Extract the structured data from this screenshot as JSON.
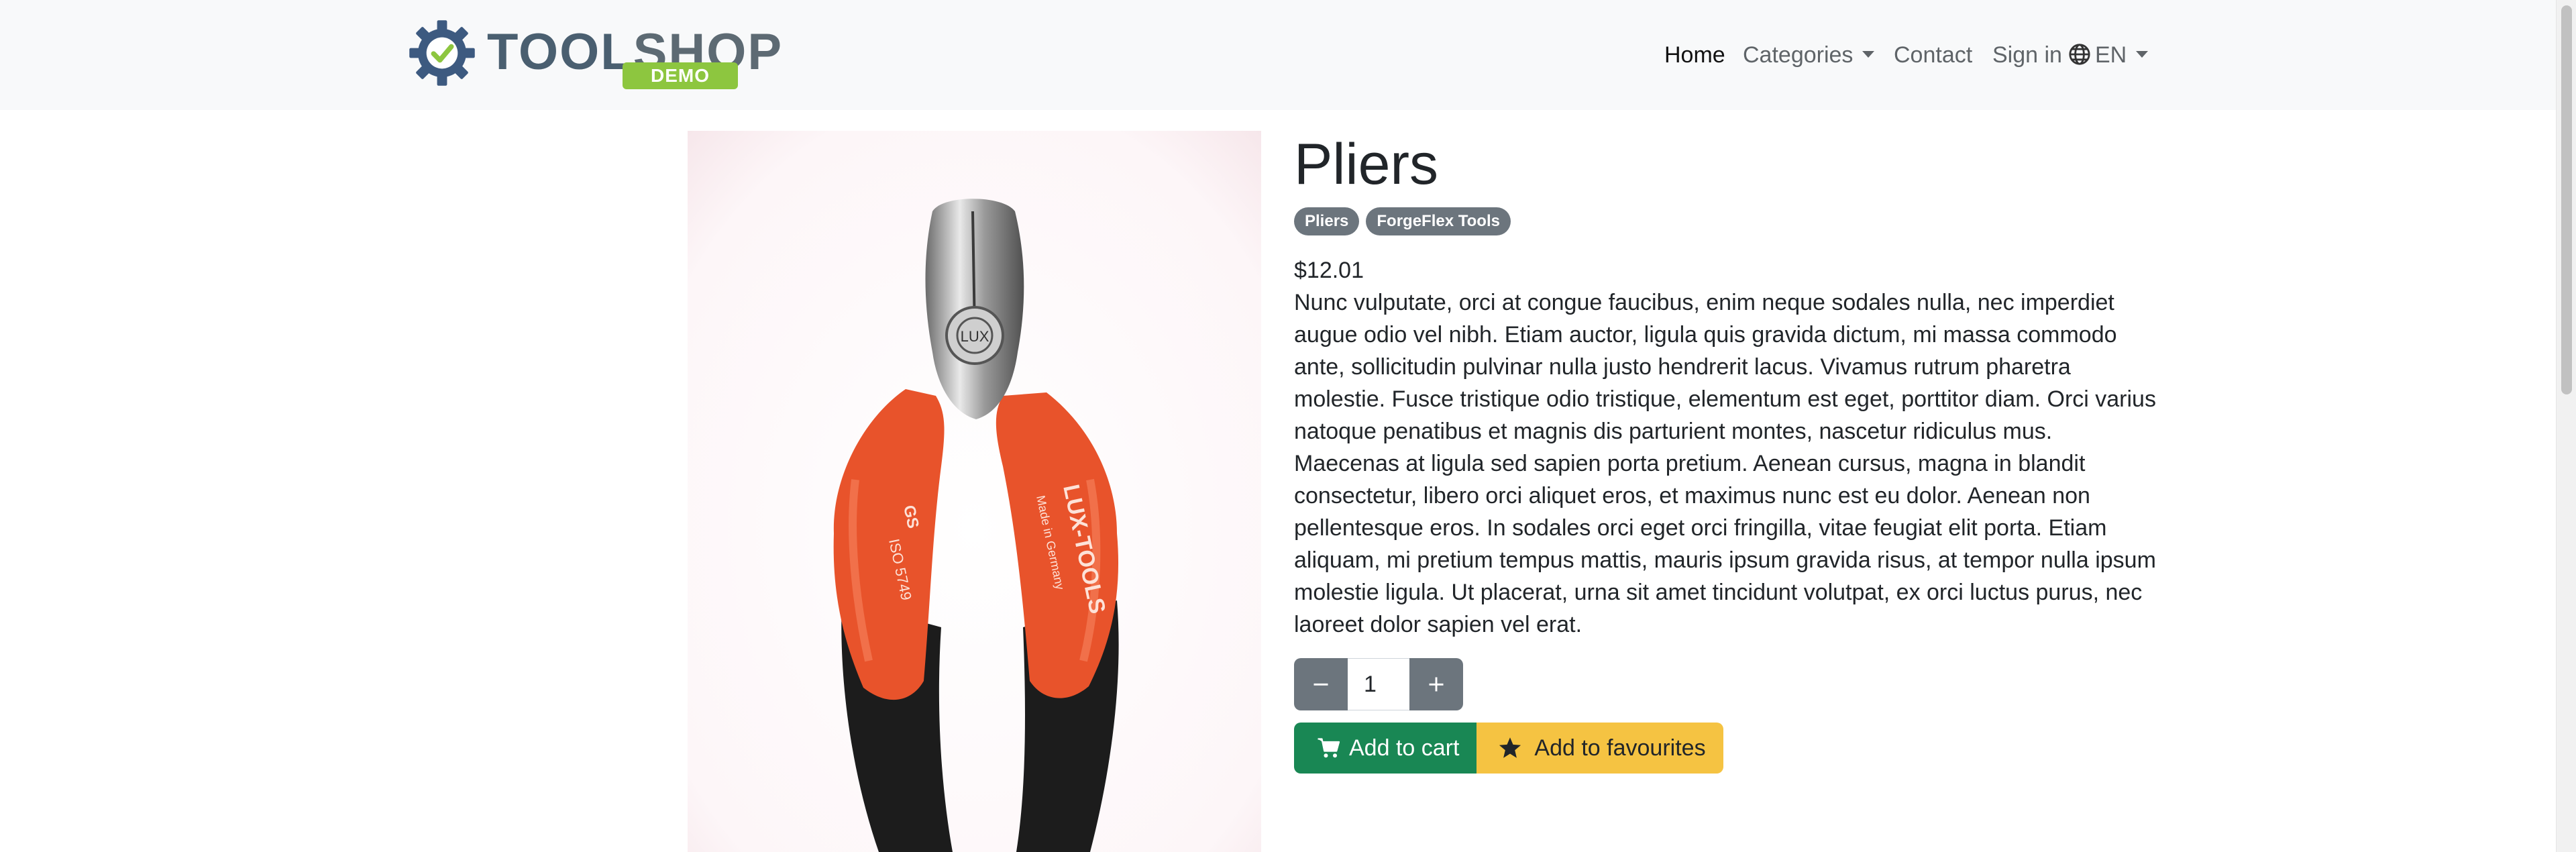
{
  "brand": {
    "word_tool": "TOOL",
    "word_shop": "SHOP",
    "tag": "DEMO",
    "colors": {
      "gear": "#3d5a80",
      "check": "#8dc63f",
      "tag": "#8dc63f"
    }
  },
  "nav": {
    "home": "Home",
    "categories": "Categories",
    "contact": "Contact",
    "sign_in": "Sign in",
    "language": "EN"
  },
  "product": {
    "title": "Pliers",
    "badges": [
      "Pliers",
      "ForgeFlex Tools"
    ],
    "price": "$12.01",
    "description": "Nunc vulputate, orci at congue faucibus, enim neque sodales nulla, nec imperdiet augue odio vel nibh. Etiam auctor, ligula quis gravida dictum, mi massa commodo ante, sollicitudin pulvinar nulla justo hendrerit lacus. Vivamus rutrum pharetra molestie. Fusce tristique odio tristique, elementum est eget, porttitor diam. Orci varius natoque penatibus et magnis dis parturient montes, nascetur ridiculus mus. Maecenas at ligula sed sapien porta pretium. Aenean cursus, magna in blandit consectetur, libero orci aliquet eros, et maximus nunc est eu dolor. Aenean non pellentesque eros. In sodales orci eget orci fringilla, vitae feugiat elit porta. Etiam aliquam, mi pretium tempus mattis, mauris ipsum gravida risus, at tempor nulla ipsum molestie ligula. Ut placerat, urna sit amet tincidunt volutpat, ex orci luctus purus, nec laoreet dolor sapien vel erat.",
    "quantity": "1",
    "image_marks": {
      "handle_text": "LUX-TOOLS",
      "sub_text": "Made in Germany",
      "iso_text": "ISO 5749",
      "gs_text": "GS",
      "head_logo": "LUX"
    }
  },
  "actions": {
    "add_to_cart": "Add to cart",
    "add_to_favourites": "Add to favourites"
  },
  "colors": {
    "cart_button": "#198754",
    "favourites_button": "#f5c342",
    "qty_button": "#6c757d",
    "badge": "#6c757d",
    "navbar_bg": "#f8f9fa"
  }
}
